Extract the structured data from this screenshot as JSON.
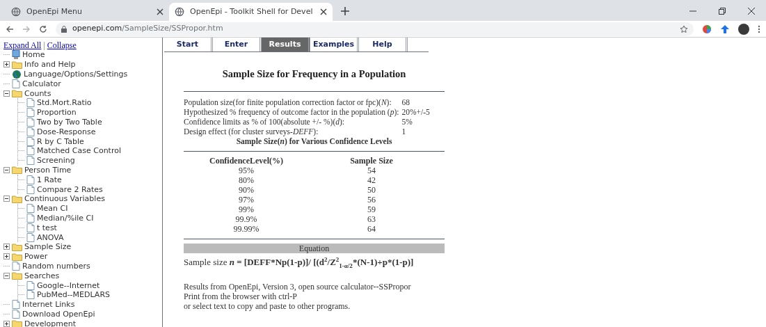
{
  "browser": {
    "tabs": [
      {
        "title": "OpenEpi Menu",
        "selected": false
      },
      {
        "title": "OpenEpi - Toolkit Shell for Devel",
        "selected": true
      }
    ],
    "url_host": "openepi.com",
    "url_path": "/SampleSize/SSPropor.htm"
  },
  "sidebar": {
    "links": [
      "Expand All",
      "Collapse"
    ],
    "separator": "|",
    "tree": [
      {
        "label": "Home",
        "kind": "home"
      },
      {
        "label": "Info and Help",
        "kind": "folder",
        "expanded": false
      },
      {
        "label": "Language/Options/Settings",
        "kind": "globe"
      },
      {
        "label": "Calculator",
        "kind": "page"
      },
      {
        "label": "Counts",
        "kind": "folder",
        "expanded": true,
        "children": [
          {
            "label": "Std.Mort.Ratio",
            "kind": "page"
          },
          {
            "label": "Proportion",
            "kind": "page"
          },
          {
            "label": "Two by Two Table",
            "kind": "page"
          },
          {
            "label": "Dose-Response",
            "kind": "page"
          },
          {
            "label": "R by C Table",
            "kind": "page"
          },
          {
            "label": "Matched Case Control",
            "kind": "page"
          },
          {
            "label": "Screening",
            "kind": "page"
          }
        ]
      },
      {
        "label": "Person Time",
        "kind": "folder",
        "expanded": true,
        "children": [
          {
            "label": "1 Rate",
            "kind": "page"
          },
          {
            "label": "Compare 2 Rates",
            "kind": "page"
          }
        ]
      },
      {
        "label": "Continuous Variables",
        "kind": "folder",
        "expanded": true,
        "children": [
          {
            "label": "Mean CI",
            "kind": "page"
          },
          {
            "label": "Median/%ile CI",
            "kind": "page"
          },
          {
            "label": "t test",
            "kind": "page"
          },
          {
            "label": "ANOVA",
            "kind": "page"
          }
        ]
      },
      {
        "label": "Sample Size",
        "kind": "folder",
        "expanded": false
      },
      {
        "label": "Power",
        "kind": "folder",
        "expanded": false
      },
      {
        "label": "Random numbers",
        "kind": "page"
      },
      {
        "label": "Searches",
        "kind": "folder",
        "expanded": true,
        "children": [
          {
            "label": "Google--Internet",
            "kind": "page"
          },
          {
            "label": "PubMed--MEDLARS",
            "kind": "page"
          }
        ]
      },
      {
        "label": "Internet Links",
        "kind": "page"
      },
      {
        "label": "Download OpenEpi",
        "kind": "page"
      },
      {
        "label": "Development",
        "kind": "folder",
        "expanded": false
      }
    ]
  },
  "nav_tabs": [
    {
      "label": "Start",
      "selected": false
    },
    {
      "label": "Enter",
      "selected": false
    },
    {
      "label": "Results",
      "selected": true
    },
    {
      "label": "Examples",
      "selected": false
    },
    {
      "label": "Help",
      "selected": false
    }
  ],
  "results": {
    "title": "Sample Size for Frequency in a Population",
    "parameters": [
      {
        "label": "Population size(for finite population correction factor or fpc)(*N*):",
        "value": "68"
      },
      {
        "label": "Hypothesized % frequency of outcome factor in the population (*p*):",
        "value": "20%+/-5"
      },
      {
        "label": "Confidence limits as % of 100(absolute +/- %)(*d*):",
        "value": "5%"
      },
      {
        "label": "Design effect (for cluster surveys-*DEFF*):",
        "value": "1"
      }
    ],
    "table_title": "Sample Size(*n*) for Various Confidence Levels",
    "table": {
      "columns": [
        "ConfidenceLevel(%)",
        "Sample Size"
      ],
      "rows": [
        [
          "95%",
          "54"
        ],
        [
          "80%",
          "42"
        ],
        [
          "90%",
          "50"
        ],
        [
          "97%",
          "56"
        ],
        [
          "99%",
          "59"
        ],
        [
          "99.9%",
          "63"
        ],
        [
          "99.99%",
          "64"
        ]
      ]
    },
    "equation_heading": "Equation",
    "equation": {
      "lead": "Sample size ",
      "symbol": "n",
      "numerator": " = [DEFF*Np(1-p)]/ [(d",
      "d_exponent": "2",
      "z_base": "/Z",
      "z_exponent": "2",
      "z_subscript": "1-α/2",
      "tail": "*(N-1)+p*(1-p)]"
    },
    "notes": [
      "Results from OpenEpi, Version 3, open source calculator--SSPropor",
      "Print from the browser with ctrl-P",
      "or select text to copy and paste to other programs."
    ]
  }
}
